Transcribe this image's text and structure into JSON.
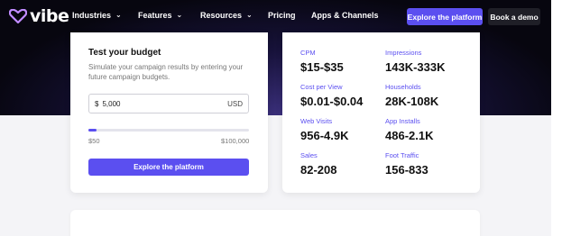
{
  "nav": {
    "logo_text": "vibe",
    "items": [
      {
        "label": "Industries",
        "dropdown": true
      },
      {
        "label": "Features",
        "dropdown": true
      },
      {
        "label": "Resources",
        "dropdown": true
      },
      {
        "label": "Pricing",
        "dropdown": false
      },
      {
        "label": "Apps & Channels",
        "dropdown": false
      }
    ],
    "explore_label": "Explore the platform",
    "demo_label": "Book a demo"
  },
  "budget": {
    "title": "Test your budget",
    "description": "Simulate your campaign results by entering your future campaign budgets.",
    "input": {
      "currency_symbol": "$",
      "value": "5,000",
      "unit": "USD"
    },
    "slider": {
      "min_label": "$50",
      "max_label": "$100,000",
      "fill_fraction": 0.05
    },
    "cta_label": "Explore the platform"
  },
  "metrics": [
    {
      "label": "CPM",
      "value": "$15-$35"
    },
    {
      "label": "Impressions",
      "value": "143K-333K"
    },
    {
      "label": "Cost per View",
      "value": "$0.01-$0.04"
    },
    {
      "label": "Households",
      "value": "28K-108K"
    },
    {
      "label": "Web Visits",
      "value": "956-4.9K"
    },
    {
      "label": "App Installs",
      "value": "486-2.1K"
    },
    {
      "label": "Sales",
      "value": "82-208"
    },
    {
      "label": "Foot Traffic",
      "value": "156-833"
    }
  ],
  "colors": {
    "accent": "#5b4ff0",
    "hero_dark": "#07060f",
    "page_bg": "#f4f4f7"
  }
}
